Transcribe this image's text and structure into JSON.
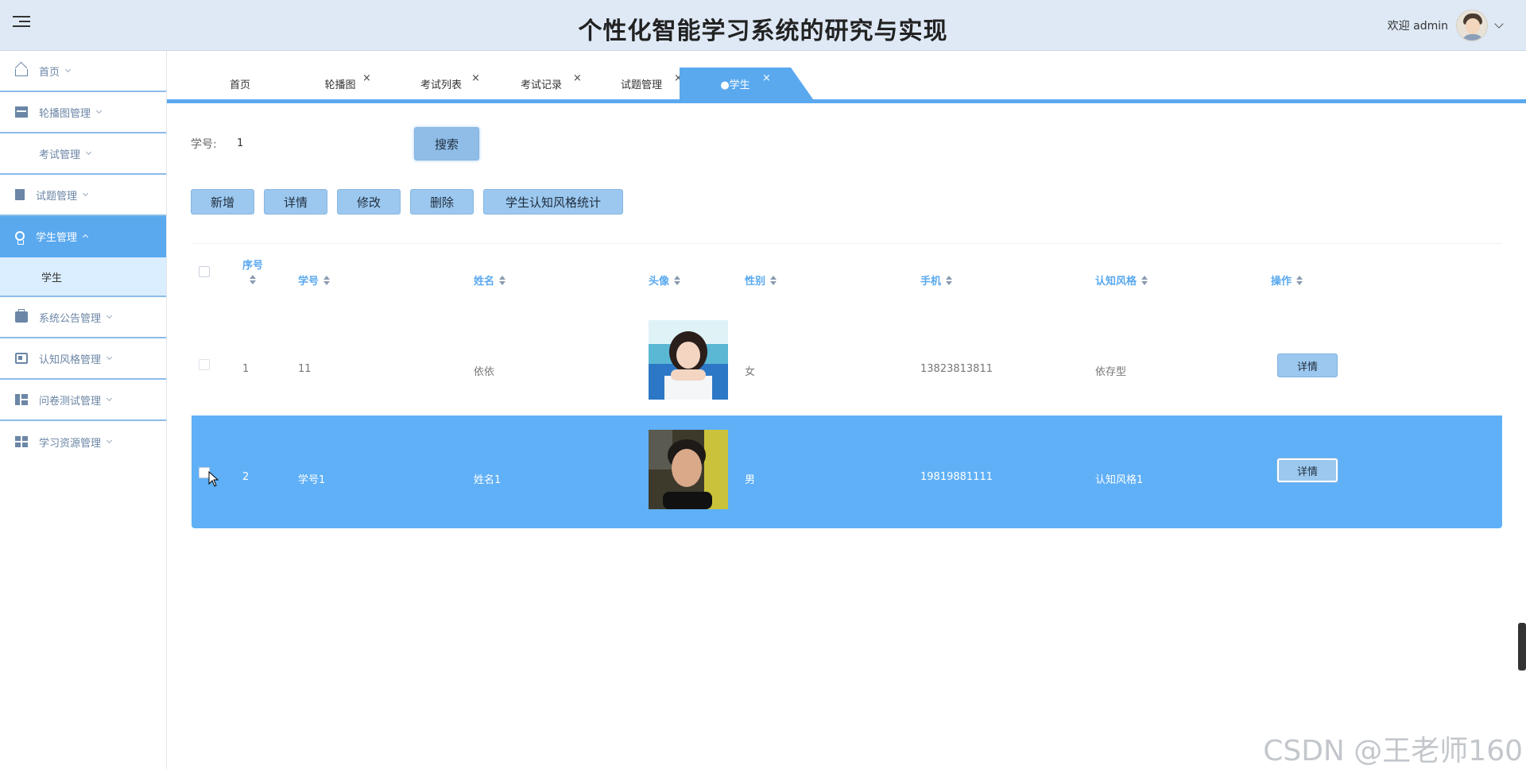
{
  "header": {
    "title": "个性化智能学习系统的研究与实现",
    "welcome": "欢迎 admin"
  },
  "sidebar": {
    "items": [
      {
        "label": "首页"
      },
      {
        "label": "轮播图管理"
      },
      {
        "label": "考试管理"
      },
      {
        "label": "试题管理"
      },
      {
        "label": "学生管理"
      },
      {
        "label": "学生"
      },
      {
        "label": "系统公告管理"
      },
      {
        "label": "认知风格管理"
      },
      {
        "label": "问卷测试管理"
      },
      {
        "label": "学习资源管理"
      }
    ]
  },
  "tabs": [
    {
      "label": "首页"
    },
    {
      "label": "轮播图",
      "close": "×"
    },
    {
      "label": "考试列表",
      "close": "×"
    },
    {
      "label": "考试记录",
      "close": "×"
    },
    {
      "label": "试题管理",
      "close": "×"
    },
    {
      "label": "●学生",
      "close": "×"
    }
  ],
  "search": {
    "label": "学号:",
    "value": "1",
    "button": "搜索"
  },
  "actions": {
    "add": "新增",
    "detail": "详情",
    "edit": "修改",
    "delete": "删除",
    "stats": "学生认知风格统计"
  },
  "table": {
    "columns": [
      "序号",
      "学号",
      "姓名",
      "头像",
      "性别",
      "手机",
      "认知风格",
      "操作"
    ],
    "rows": [
      {
        "index": "1",
        "student_no": "11",
        "name": "依依",
        "gender": "女",
        "phone": "13823813811",
        "style": "依存型",
        "action": "详情",
        "avatar": "female-student-photo"
      },
      {
        "index": "2",
        "student_no": "学号1",
        "name": "姓名1",
        "gender": "男",
        "phone": "19819881111",
        "style": "认知风格1",
        "action": "详情",
        "avatar": "male-student-photo"
      }
    ]
  },
  "watermark": "CSDN @王老师160",
  "colors": {
    "accent": "#5aa9ef",
    "header_bg": "#dfe9f6",
    "button_bg": "#9cc8ef",
    "selected_row": "#5fb0f7"
  }
}
